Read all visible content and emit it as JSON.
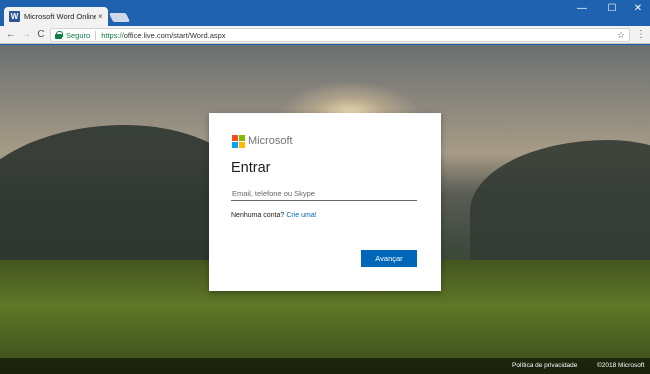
{
  "browser": {
    "tab_title": "Microsoft Word Online -",
    "tab_close": "×",
    "window_controls": {
      "minimize": "—",
      "maximize": "☐",
      "close": "✕"
    },
    "nav": {
      "back": "←",
      "forward": "→",
      "reload": "C"
    },
    "secure_label": "Seguro",
    "url_scheme": "https://",
    "url_rest": "office.live.com/start/Word.aspx",
    "star": "☆",
    "menu": "⋮"
  },
  "signin": {
    "brand": "Microsoft",
    "title": "Entrar",
    "email_placeholder": "Email, telefone ou Skype",
    "email_value": "",
    "no_account_text": "Nenhuma conta?",
    "create_link": "Crie uma!",
    "next_button": "Avançar"
  },
  "footer": {
    "privacy_link": "Política de privacidade",
    "copyright": "©2018 Microsoft"
  },
  "colors": {
    "chrome_titlebar": "#1f62b0",
    "accent": "#0067b8",
    "secure_green": "#0b8043",
    "logo": [
      "#f25022",
      "#7fba00",
      "#00a4ef",
      "#ffb900"
    ]
  }
}
